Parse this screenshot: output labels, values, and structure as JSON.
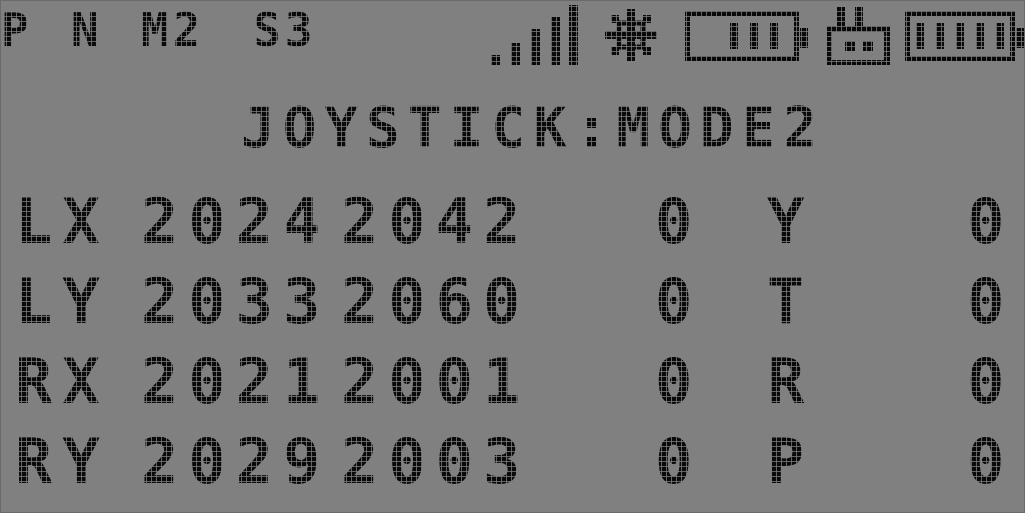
{
  "status": {
    "p": "P",
    "n": "N",
    "model": "M2",
    "slot": "S3"
  },
  "icons": [
    "signal-icon",
    "backlight-icon",
    "tx-battery-icon",
    "rx-icon",
    "rx-battery-icon"
  ],
  "title": "JOYSTICK:MODE2",
  "rows": [
    {
      "axis": "LX",
      "raw": "2024",
      "cal": "2042",
      "value": "0",
      "channel": "Y",
      "channel_value": "0"
    },
    {
      "axis": "LY",
      "raw": "2033",
      "cal": "2060",
      "value": "0",
      "channel": "T",
      "channel_value": "0"
    },
    {
      "axis": "RX",
      "raw": "2021",
      "cal": "2001",
      "value": "0",
      "channel": "R",
      "channel_value": "0"
    },
    {
      "axis": "RY",
      "raw": "2029",
      "cal": "2003",
      "value": "0",
      "channel": "P",
      "channel_value": "0"
    }
  ]
}
